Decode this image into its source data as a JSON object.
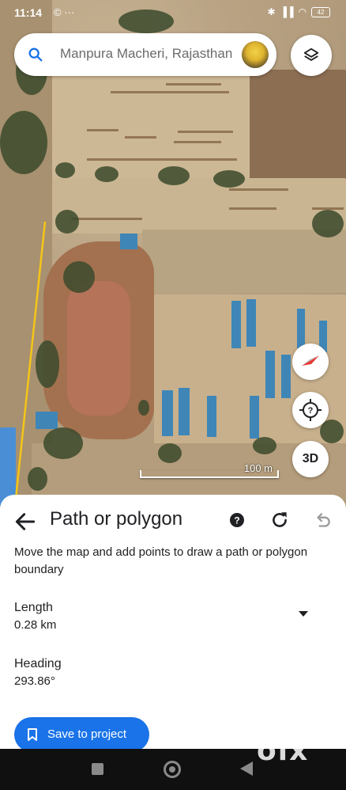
{
  "status_bar": {
    "time": "11:14",
    "left_icons": "© ···",
    "battery": "42"
  },
  "search": {
    "value": "Manpura Macheri, Rajasthan"
  },
  "map": {
    "scale_label": "100 m",
    "three_d_label": "3D"
  },
  "sheet": {
    "title": "Path or polygon",
    "instruction": "Move the map and add points to draw a path or polygon boundary",
    "length_label": "Length",
    "length_value": "0.28 km",
    "heading_label": "Heading",
    "heading_value": "293.86°",
    "save_label": "Save to project"
  },
  "watermark": "olx",
  "colors": {
    "accent": "#1a73e8",
    "path_line": "#f5c518"
  }
}
